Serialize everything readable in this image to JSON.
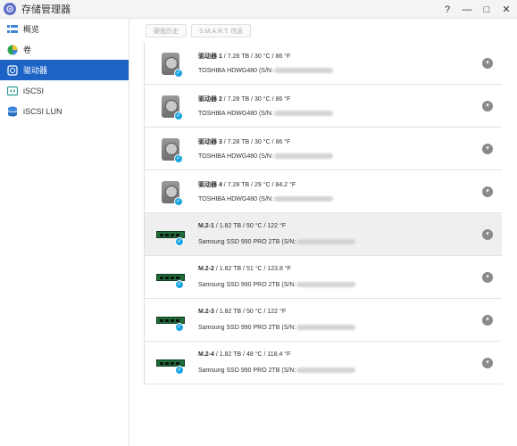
{
  "window": {
    "title": "存储管理器",
    "controls": [
      "?",
      "—",
      "□",
      "✕"
    ]
  },
  "sidebar": {
    "items": [
      {
        "label": "概览",
        "icon": "overview-icon",
        "active": false
      },
      {
        "label": "卷",
        "icon": "volume-icon",
        "active": false
      },
      {
        "label": "驱动器",
        "icon": "drive-icon",
        "active": true
      },
      {
        "label": "iSCSI",
        "icon": "iscsi-icon",
        "active": false
      },
      {
        "label": "iSCSI LUN",
        "icon": "iscsi-lun-icon",
        "active": false
      }
    ]
  },
  "toolbar": {
    "history_label": "硬盘历史",
    "smart_label": "S.M.A.R.T. 信息"
  },
  "drives": [
    {
      "name": "驱动器 1",
      "info": "/ 7.28 TB / 30 °C / 86 °F",
      "model": "TOSHIBA HDWG480 (S/N:",
      "type": "hdd",
      "selected": false
    },
    {
      "name": "驱动器 2",
      "info": "/ 7.28 TB / 30 °C / 86 °F",
      "model": "TOSHIBA HDWG480 (S/N:",
      "type": "hdd",
      "selected": false
    },
    {
      "name": "驱动器 3",
      "info": "/ 7.28 TB / 30 °C / 86 °F",
      "model": "TOSHIBA HDWG480 (S/N:",
      "type": "hdd",
      "selected": false
    },
    {
      "name": "驱动器 4",
      "info": "/ 7.28 TB / 29 °C / 84.2 °F",
      "model": "TOSHIBA HDWG480 (S/N:",
      "type": "hdd",
      "selected": false
    },
    {
      "name": "M.2-1",
      "info": "/ 1.82 TB / 50 °C / 122 °F",
      "model": "Samsung SSD 990 PRO 2TB (S/N:",
      "type": "ssd",
      "selected": true
    },
    {
      "name": "M.2-2",
      "info": "/ 1.82 TB / 51 °C / 123.8 °F",
      "model": "Samsung SSD 990 PRO 2TB (S/N:",
      "type": "ssd",
      "selected": false
    },
    {
      "name": "M.2-3",
      "info": "/ 1.82 TB / 50 °C / 122 °F",
      "model": "Samsung SSD 990 PRO 2TB (S/N:",
      "type": "ssd",
      "selected": false
    },
    {
      "name": "M.2-4",
      "info": "/ 1.82 TB / 48 °C / 118.4 °F",
      "model": "Samsung SSD 990 PRO 2TB (S/N:",
      "type": "ssd",
      "selected": false
    }
  ]
}
